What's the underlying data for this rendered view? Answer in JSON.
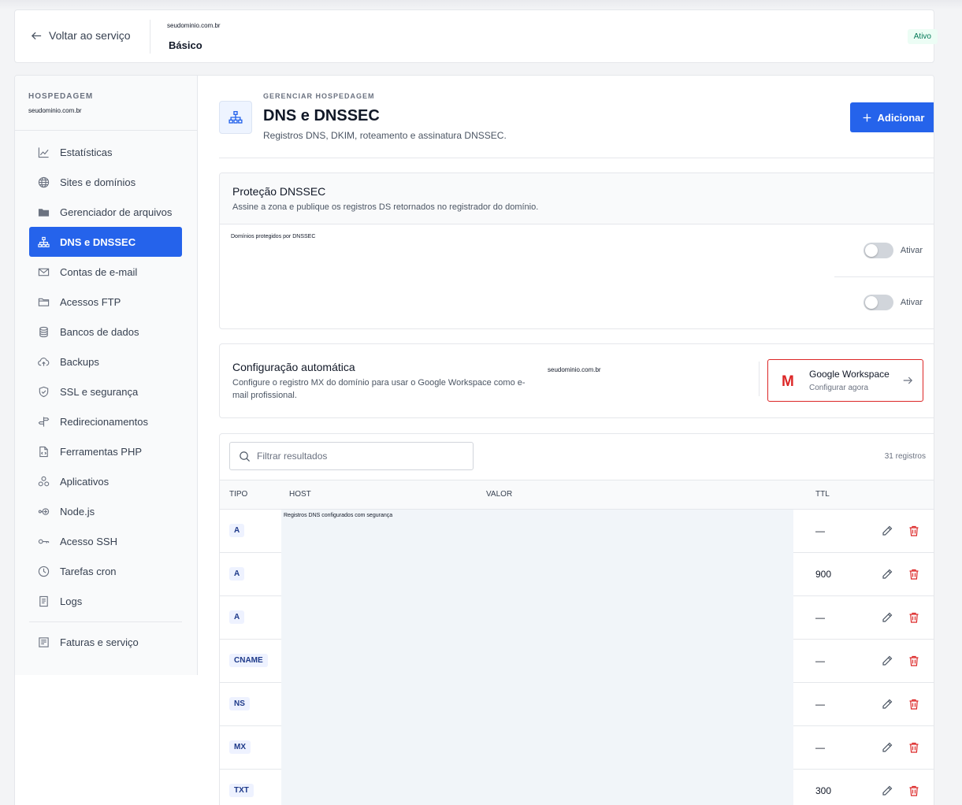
{
  "topbar": {
    "back_label": "Voltar ao serviço",
    "domain": "seudominio.com.br",
    "plan": "Básico",
    "status": "Ativo"
  },
  "sidebar": {
    "section_label": "HOSPEDAGEM",
    "domain": "seudominio.com.br",
    "items": [
      {
        "label": "Estatísticas",
        "icon": "chart-line-icon"
      },
      {
        "label": "Sites e domínios",
        "icon": "globe-icon"
      },
      {
        "label": "Gerenciador de arquivos",
        "icon": "folder-icon"
      },
      {
        "label": "DNS e DNSSEC",
        "icon": "sitemap-icon",
        "active": true
      },
      {
        "label": "Contas de e-mail",
        "icon": "envelope-icon"
      },
      {
        "label": "Acessos FTP",
        "icon": "folder-outline-icon"
      },
      {
        "label": "Bancos de dados",
        "icon": "database-icon"
      },
      {
        "label": "Backups",
        "icon": "cloud-upload-icon"
      },
      {
        "label": "SSL e segurança",
        "icon": "shield-icon"
      },
      {
        "label": "Redirecionamentos",
        "icon": "signpost-icon"
      },
      {
        "label": "Ferramentas PHP",
        "icon": "file-code-icon"
      },
      {
        "label": "Aplicativos",
        "icon": "apps-icon"
      },
      {
        "label": "Node.js",
        "icon": "node-icon"
      },
      {
        "label": "Acesso SSH",
        "icon": "key-icon"
      },
      {
        "label": "Tarefas cron",
        "icon": "clock-icon"
      },
      {
        "label": "Logs",
        "icon": "log-file-icon"
      }
    ],
    "footer_item": {
      "label": "Faturas e serviço",
      "icon": "invoice-icon"
    }
  },
  "header": {
    "eyebrow": "GERENCIAR HOSPEDAGEM",
    "title": "DNS e DNSSEC",
    "subtitle": "Registros DNS, DKIM, roteamento e assinatura DNSSEC.",
    "add_button": "Adicionar"
  },
  "dnssec": {
    "title": "Proteção DNSSEC",
    "description": "Assine a zona e publique os registros DS retornados no registrador do domínio.",
    "protected_label": "Domínios protegidos por DNSSEC",
    "toggles": [
      {
        "label": "Ativar",
        "on": false
      },
      {
        "label": "Ativar",
        "on": false
      }
    ]
  },
  "auto_config": {
    "title": "Configuração automática",
    "description": "Configure o registro MX do domínio para usar o Google Workspace como e-mail profissional.",
    "domain": "seudominio.com.br",
    "provider": {
      "logo": "M",
      "name": "Google Workspace",
      "action": "Configurar agora"
    }
  },
  "records": {
    "search_placeholder": "Filtrar resultados",
    "count": "31 registros",
    "columns": {
      "type": "TIPO",
      "host": "HOST",
      "value": "VALOR",
      "ttl": "TTL"
    },
    "overlay_label": "Registros DNS configurados com segurança",
    "rows": [
      {
        "type": "A",
        "ttl": "—"
      },
      {
        "type": "A",
        "ttl": "900"
      },
      {
        "type": "A",
        "ttl": "—"
      },
      {
        "type": "CNAME",
        "ttl": "—"
      },
      {
        "type": "NS",
        "ttl": "—"
      },
      {
        "type": "MX",
        "ttl": "—"
      },
      {
        "type": "TXT",
        "ttl": "300"
      }
    ]
  },
  "colors": {
    "accent": "#2563eb",
    "danger": "#dc2626",
    "success_text": "#047857"
  }
}
